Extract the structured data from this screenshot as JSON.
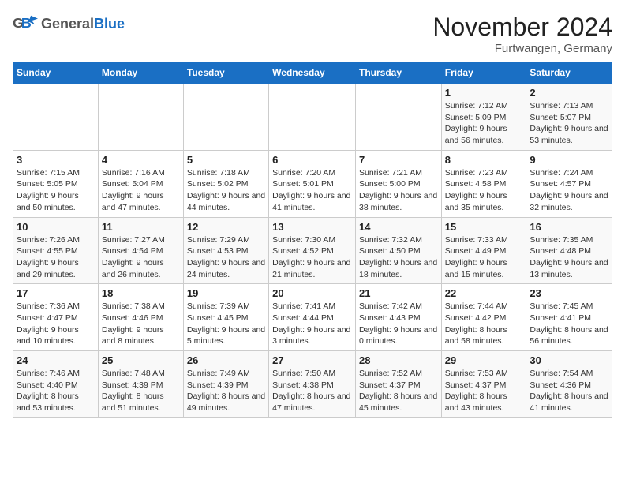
{
  "header": {
    "logo_general": "General",
    "logo_blue": "Blue",
    "month": "November 2024",
    "location": "Furtwangen, Germany"
  },
  "weekdays": [
    "Sunday",
    "Monday",
    "Tuesday",
    "Wednesday",
    "Thursday",
    "Friday",
    "Saturday"
  ],
  "weeks": [
    [
      {
        "day": "",
        "info": ""
      },
      {
        "day": "",
        "info": ""
      },
      {
        "day": "",
        "info": ""
      },
      {
        "day": "",
        "info": ""
      },
      {
        "day": "",
        "info": ""
      },
      {
        "day": "1",
        "info": "Sunrise: 7:12 AM\nSunset: 5:09 PM\nDaylight: 9 hours and 56 minutes."
      },
      {
        "day": "2",
        "info": "Sunrise: 7:13 AM\nSunset: 5:07 PM\nDaylight: 9 hours and 53 minutes."
      }
    ],
    [
      {
        "day": "3",
        "info": "Sunrise: 7:15 AM\nSunset: 5:05 PM\nDaylight: 9 hours and 50 minutes."
      },
      {
        "day": "4",
        "info": "Sunrise: 7:16 AM\nSunset: 5:04 PM\nDaylight: 9 hours and 47 minutes."
      },
      {
        "day": "5",
        "info": "Sunrise: 7:18 AM\nSunset: 5:02 PM\nDaylight: 9 hours and 44 minutes."
      },
      {
        "day": "6",
        "info": "Sunrise: 7:20 AM\nSunset: 5:01 PM\nDaylight: 9 hours and 41 minutes."
      },
      {
        "day": "7",
        "info": "Sunrise: 7:21 AM\nSunset: 5:00 PM\nDaylight: 9 hours and 38 minutes."
      },
      {
        "day": "8",
        "info": "Sunrise: 7:23 AM\nSunset: 4:58 PM\nDaylight: 9 hours and 35 minutes."
      },
      {
        "day": "9",
        "info": "Sunrise: 7:24 AM\nSunset: 4:57 PM\nDaylight: 9 hours and 32 minutes."
      }
    ],
    [
      {
        "day": "10",
        "info": "Sunrise: 7:26 AM\nSunset: 4:55 PM\nDaylight: 9 hours and 29 minutes."
      },
      {
        "day": "11",
        "info": "Sunrise: 7:27 AM\nSunset: 4:54 PM\nDaylight: 9 hours and 26 minutes."
      },
      {
        "day": "12",
        "info": "Sunrise: 7:29 AM\nSunset: 4:53 PM\nDaylight: 9 hours and 24 minutes."
      },
      {
        "day": "13",
        "info": "Sunrise: 7:30 AM\nSunset: 4:52 PM\nDaylight: 9 hours and 21 minutes."
      },
      {
        "day": "14",
        "info": "Sunrise: 7:32 AM\nSunset: 4:50 PM\nDaylight: 9 hours and 18 minutes."
      },
      {
        "day": "15",
        "info": "Sunrise: 7:33 AM\nSunset: 4:49 PM\nDaylight: 9 hours and 15 minutes."
      },
      {
        "day": "16",
        "info": "Sunrise: 7:35 AM\nSunset: 4:48 PM\nDaylight: 9 hours and 13 minutes."
      }
    ],
    [
      {
        "day": "17",
        "info": "Sunrise: 7:36 AM\nSunset: 4:47 PM\nDaylight: 9 hours and 10 minutes."
      },
      {
        "day": "18",
        "info": "Sunrise: 7:38 AM\nSunset: 4:46 PM\nDaylight: 9 hours and 8 minutes."
      },
      {
        "day": "19",
        "info": "Sunrise: 7:39 AM\nSunset: 4:45 PM\nDaylight: 9 hours and 5 minutes."
      },
      {
        "day": "20",
        "info": "Sunrise: 7:41 AM\nSunset: 4:44 PM\nDaylight: 9 hours and 3 minutes."
      },
      {
        "day": "21",
        "info": "Sunrise: 7:42 AM\nSunset: 4:43 PM\nDaylight: 9 hours and 0 minutes."
      },
      {
        "day": "22",
        "info": "Sunrise: 7:44 AM\nSunset: 4:42 PM\nDaylight: 8 hours and 58 minutes."
      },
      {
        "day": "23",
        "info": "Sunrise: 7:45 AM\nSunset: 4:41 PM\nDaylight: 8 hours and 56 minutes."
      }
    ],
    [
      {
        "day": "24",
        "info": "Sunrise: 7:46 AM\nSunset: 4:40 PM\nDaylight: 8 hours and 53 minutes."
      },
      {
        "day": "25",
        "info": "Sunrise: 7:48 AM\nSunset: 4:39 PM\nDaylight: 8 hours and 51 minutes."
      },
      {
        "day": "26",
        "info": "Sunrise: 7:49 AM\nSunset: 4:39 PM\nDaylight: 8 hours and 49 minutes."
      },
      {
        "day": "27",
        "info": "Sunrise: 7:50 AM\nSunset: 4:38 PM\nDaylight: 8 hours and 47 minutes."
      },
      {
        "day": "28",
        "info": "Sunrise: 7:52 AM\nSunset: 4:37 PM\nDaylight: 8 hours and 45 minutes."
      },
      {
        "day": "29",
        "info": "Sunrise: 7:53 AM\nSunset: 4:37 PM\nDaylight: 8 hours and 43 minutes."
      },
      {
        "day": "30",
        "info": "Sunrise: 7:54 AM\nSunset: 4:36 PM\nDaylight: 8 hours and 41 minutes."
      }
    ]
  ]
}
